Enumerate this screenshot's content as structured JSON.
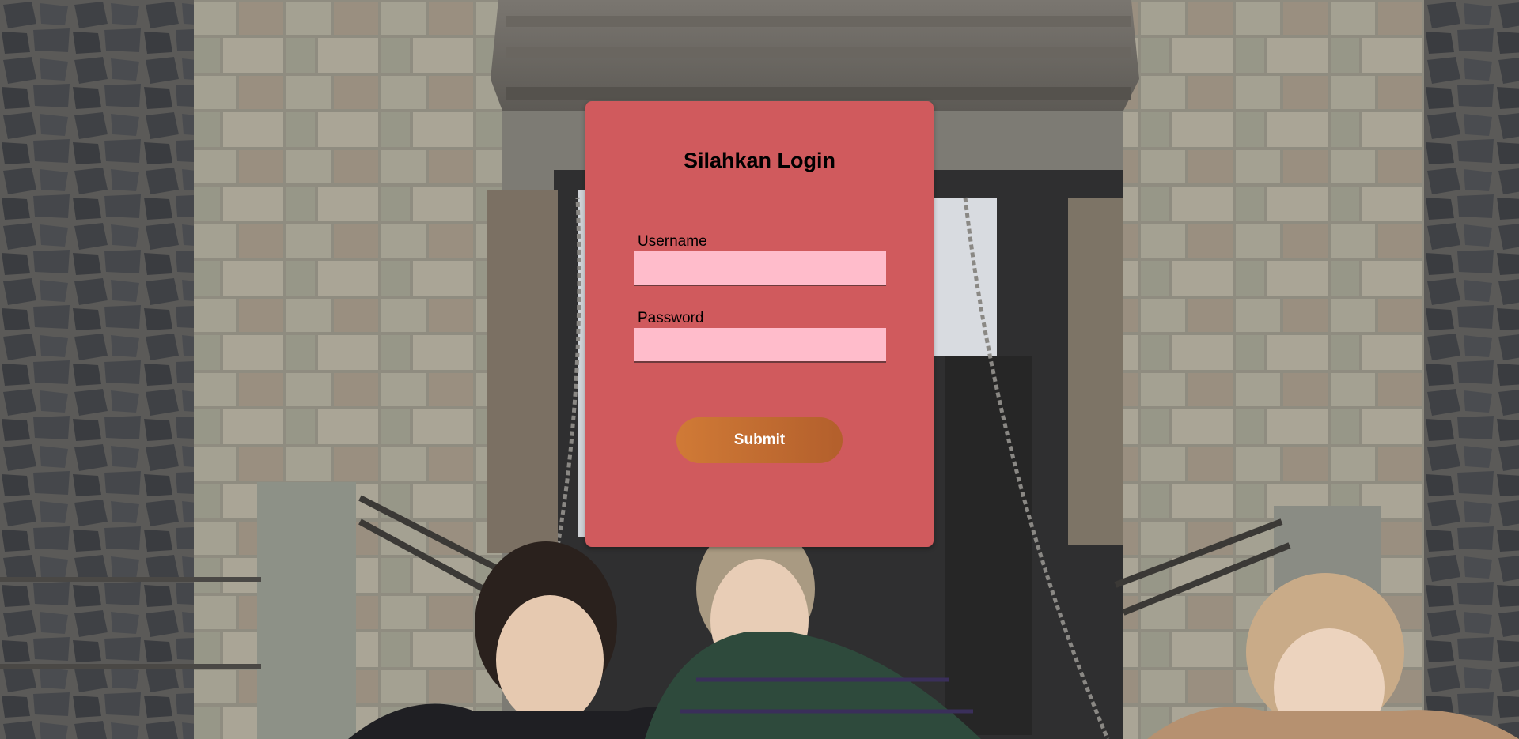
{
  "login": {
    "title": "Silahkan Login",
    "username_label": "Username",
    "username_value": "",
    "password_label": "Password",
    "password_value": "",
    "submit_label": "Submit"
  },
  "colors": {
    "card_background": "#d05a5d",
    "input_background": "#ffbccb",
    "button_gradient_start": "#d07a36",
    "button_gradient_end": "#b35f2c"
  }
}
